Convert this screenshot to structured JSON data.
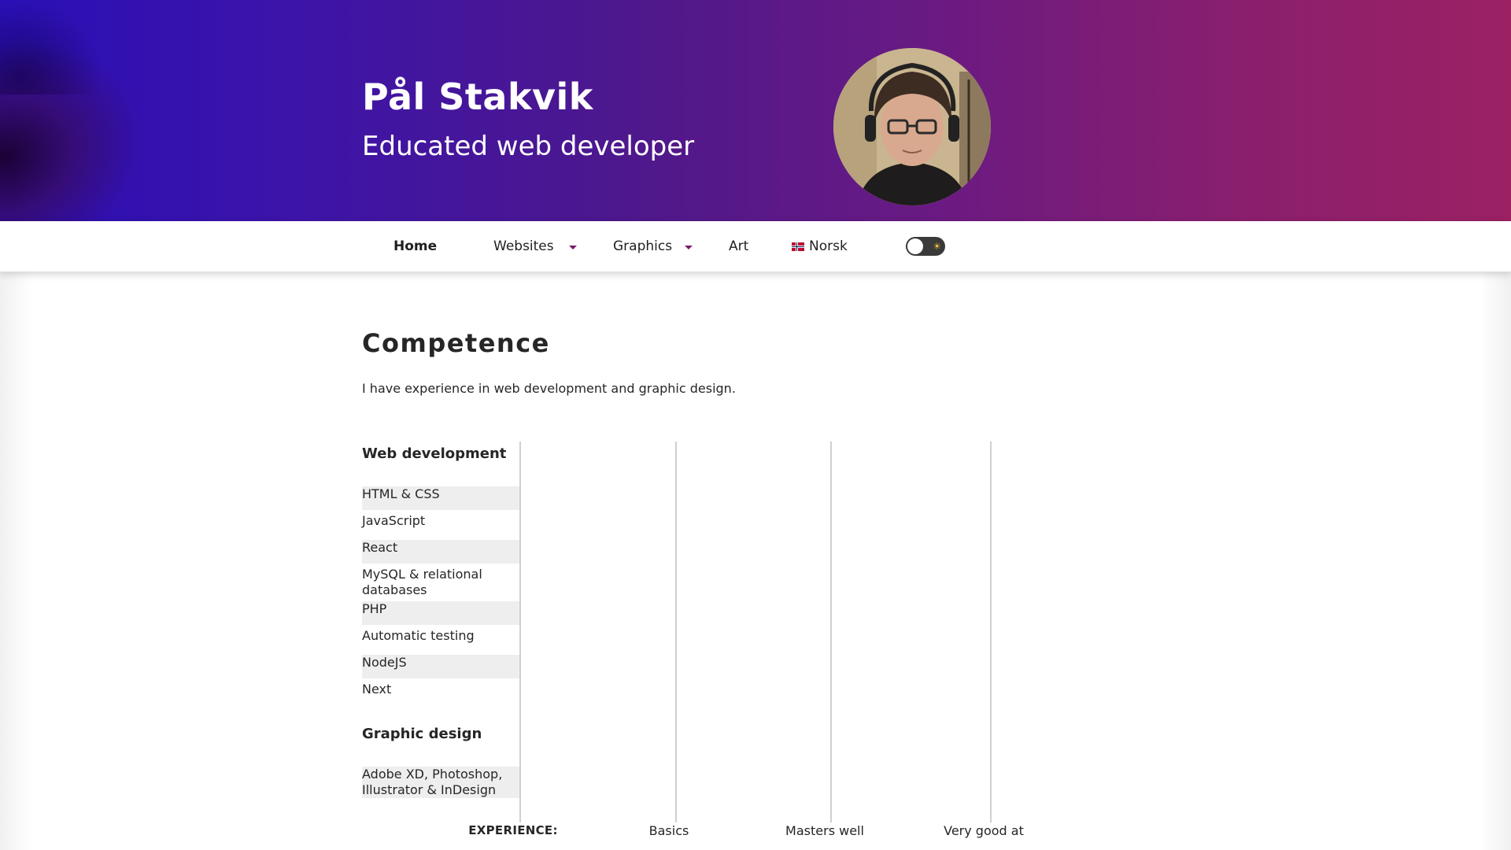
{
  "header": {
    "name": "Pål Stakvik",
    "subtitle": "Educated web developer",
    "avatar_alt": "avatar"
  },
  "nav": {
    "items": [
      {
        "label": "Home",
        "active": true
      },
      {
        "label": "Websites",
        "dropdown": true
      },
      {
        "label": "Graphics",
        "dropdown": true
      },
      {
        "label": "Art"
      },
      {
        "label": "Norsk",
        "icon": "norway-flag-icon"
      }
    ],
    "theme_toggle": {
      "state": "light",
      "icon": "sun-icon"
    }
  },
  "competence": {
    "title": "Competence",
    "intro": "I have experience in web development and graphic design.",
    "groups": [
      {
        "title": "Web development",
        "skills": [
          "HTML & CSS",
          "JavaScript",
          "React",
          "MySQL & relational databases",
          "PHP",
          "Automatic testing",
          "NodeJS",
          "Next"
        ]
      },
      {
        "title": "Graphic design",
        "skills": [
          "Adobe XD, Photoshop, Illustrator & InDesign"
        ]
      }
    ],
    "scale": {
      "heading": "EXPERIENCE:",
      "levels": [
        "Basics",
        "Masters well",
        "Very good at"
      ]
    }
  },
  "colors": {
    "header_gradient_start": "#2a0fb6",
    "header_gradient_end": "#9b2163",
    "accent_caret": "#7a1c6c",
    "row_shade": "#eeeeee"
  }
}
